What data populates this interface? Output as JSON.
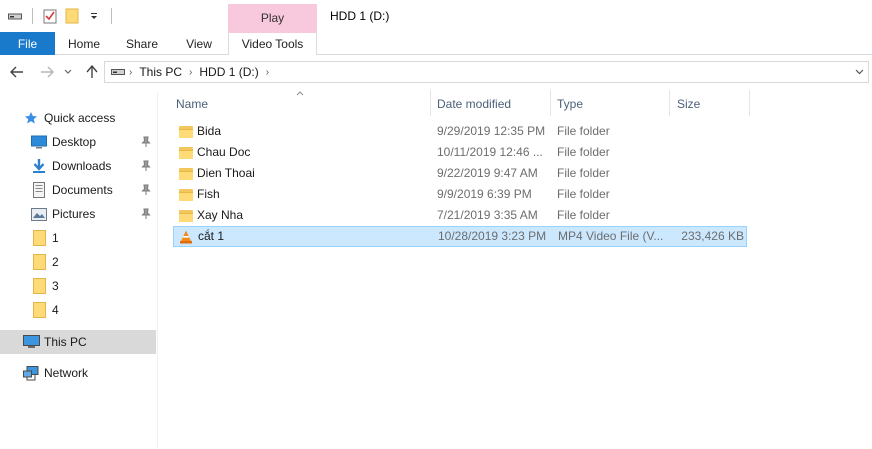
{
  "window": {
    "title": "HDD 1 (D:)",
    "context_tab_header": "Play"
  },
  "ribbon": {
    "tabs": [
      {
        "label": "File"
      },
      {
        "label": "Home"
      },
      {
        "label": "Share"
      },
      {
        "label": "View"
      },
      {
        "label": "Video Tools"
      }
    ]
  },
  "address": {
    "crumbs": [
      "This PC",
      "HDD 1 (D:)"
    ]
  },
  "nav": {
    "quick_access": "Quick access",
    "pinned": [
      {
        "label": "Desktop",
        "icon": "desktop-icon"
      },
      {
        "label": "Downloads",
        "icon": "downloads-icon"
      },
      {
        "label": "Documents",
        "icon": "documents-icon"
      },
      {
        "label": "Pictures",
        "icon": "pictures-icon"
      }
    ],
    "folders": [
      "1",
      "2",
      "3",
      "4"
    ],
    "this_pc": "This PC",
    "network": "Network"
  },
  "columns": {
    "name": "Name",
    "date": "Date modified",
    "type": "Type",
    "size": "Size"
  },
  "files": [
    {
      "name": "Bida",
      "date": "9/29/2019 12:35 PM",
      "type": "File folder",
      "size": "",
      "icon": "folder-icon"
    },
    {
      "name": "Chau Doc",
      "date": "10/11/2019 12:46 ...",
      "type": "File folder",
      "size": "",
      "icon": "folder-icon"
    },
    {
      "name": "Dien Thoai",
      "date": "9/22/2019 9:47 AM",
      "type": "File folder",
      "size": "",
      "icon": "folder-icon"
    },
    {
      "name": "Fish",
      "date": "9/9/2019 6:39 PM",
      "type": "File folder",
      "size": "",
      "icon": "folder-icon"
    },
    {
      "name": "Xay Nha",
      "date": "7/21/2019 3:35 AM",
      "type": "File folder",
      "size": "",
      "icon": "folder-icon"
    },
    {
      "name": "cắt 1",
      "date": "10/28/2019 3:23 PM",
      "type": "MP4 Video File (V...",
      "size": "233,426 KB",
      "icon": "vlc-icon"
    }
  ],
  "colors": {
    "file_tab": "#1979ca",
    "context_tab": "#f8c8dc",
    "selection_bg": "#cce8ff",
    "selection_border": "#99d1ff",
    "header_text": "#4c607a"
  }
}
